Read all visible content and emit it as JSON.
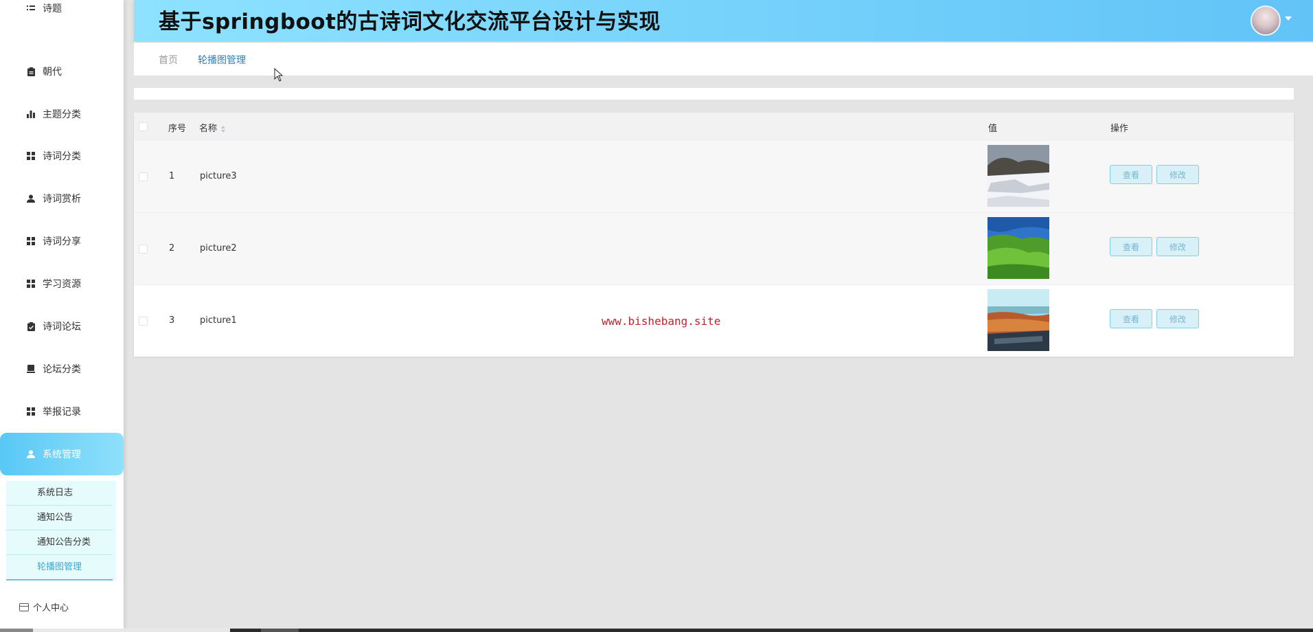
{
  "app": {
    "title": "基于springboot的古诗词文化交流平台设计与实现"
  },
  "sidebar": {
    "top_partial_label": "诗题",
    "items": [
      {
        "label": "朝代",
        "icon": "clipboard-icon"
      },
      {
        "label": "主题分类",
        "icon": "bar-chart-icon"
      },
      {
        "label": "诗词分类",
        "icon": "grid-icon"
      },
      {
        "label": "诗词赏析",
        "icon": "user-icon"
      },
      {
        "label": "诗词分享",
        "icon": "grid-icon"
      },
      {
        "label": "学习资源",
        "icon": "grid-icon"
      },
      {
        "label": "诗词论坛",
        "icon": "clipboard-check-icon"
      },
      {
        "label": "论坛分类",
        "icon": "box-icon"
      },
      {
        "label": "举报记录",
        "icon": "grid-icon"
      },
      {
        "label": "系统管理",
        "icon": "user-icon",
        "active": true
      }
    ],
    "submenu": [
      {
        "label": "系统日志"
      },
      {
        "label": "通知公告"
      },
      {
        "label": "通知公告分类"
      },
      {
        "label": "轮播图管理",
        "active": true
      }
    ],
    "personal_center": "个人中心"
  },
  "breadcrumb": {
    "home": "首页",
    "current": "轮播图管理"
  },
  "table": {
    "headers": {
      "index": "序号",
      "name": "名称",
      "value": "值",
      "actions": "操作"
    },
    "rows": [
      {
        "index": "1",
        "name": "picture3",
        "image": "snowy-mountain-photo"
      },
      {
        "index": "2",
        "name": "picture2",
        "image": "green-hills-photo"
      },
      {
        "index": "3",
        "name": "picture1",
        "image": "sunset-lake-photo"
      }
    ],
    "view_label": "查看",
    "edit_label": "修改"
  },
  "watermark": "www.bishebang.site",
  "colors": {
    "header_gradient_start": "#8de2ff",
    "header_gradient_end": "#61c3f7",
    "active_menu": "#59c8f5",
    "breadcrumb_current": "#2f7fb0",
    "button_border": "#7fcde9",
    "watermark": "#c6202a"
  }
}
